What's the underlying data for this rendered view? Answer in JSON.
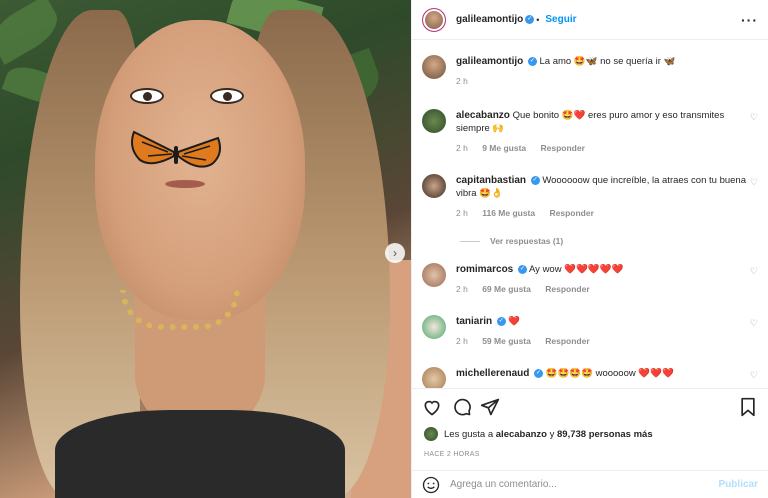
{
  "header": {
    "username": "galileamontijo",
    "follow_label": "Seguir",
    "more_label": "···"
  },
  "caption": {
    "username": "galileamontijo",
    "text": "La amo 🤩🦋 no se quería ir 🦋",
    "time": "2 h"
  },
  "comments": [
    {
      "username": "alecabanzo",
      "verified": false,
      "text": "Que bonito 🤩❤️ eres puro amor y eso transmites siempre 🙌",
      "time": "2 h",
      "likes": "9 Me gusta",
      "reply": "Responder"
    },
    {
      "username": "capitanbastian",
      "verified": true,
      "text": "Woooooow que increíble, la atraes con tu buena vibra 🤩👌",
      "time": "2 h",
      "likes": "116 Me gusta",
      "reply": "Responder"
    },
    {
      "username": "romimarcos",
      "verified": true,
      "text": "Ay wow ❤️❤️❤️❤️❤️",
      "time": "2 h",
      "likes": "69 Me gusta",
      "reply": "Responder"
    },
    {
      "username": "taniarin",
      "verified": true,
      "text": "❤️",
      "time": "2 h",
      "likes": "59 Me gusta",
      "reply": "Responder"
    },
    {
      "username": "michellerenaud",
      "verified": true,
      "text": "🤩🤩🤩🤩 wooooow ❤️❤️❤️",
      "time": "",
      "likes": "",
      "reply": ""
    }
  ],
  "view_replies": "Ver respuestas (1)",
  "likes_line": {
    "prefix": "Les gusta a",
    "user": "alecabanzo",
    "middle": "y",
    "count": "89,738 personas más"
  },
  "timestamp": "HACE 2 HORAS",
  "comment_box": {
    "placeholder": "Agrega un comentario...",
    "publish_label": "Publicar"
  },
  "icons": {
    "like": "heart-icon",
    "comment": "comment-icon",
    "share": "share-icon",
    "save": "bookmark-icon",
    "emoji": "emoji-icon",
    "verified": "verified-badge-icon",
    "next": "chevron-right-icon"
  },
  "colors": {
    "accent": "#0095f6",
    "verified": "#3897f0",
    "text": "#262626",
    "muted": "#8e8e8e",
    "publish_disabled": "#b2dffc"
  }
}
